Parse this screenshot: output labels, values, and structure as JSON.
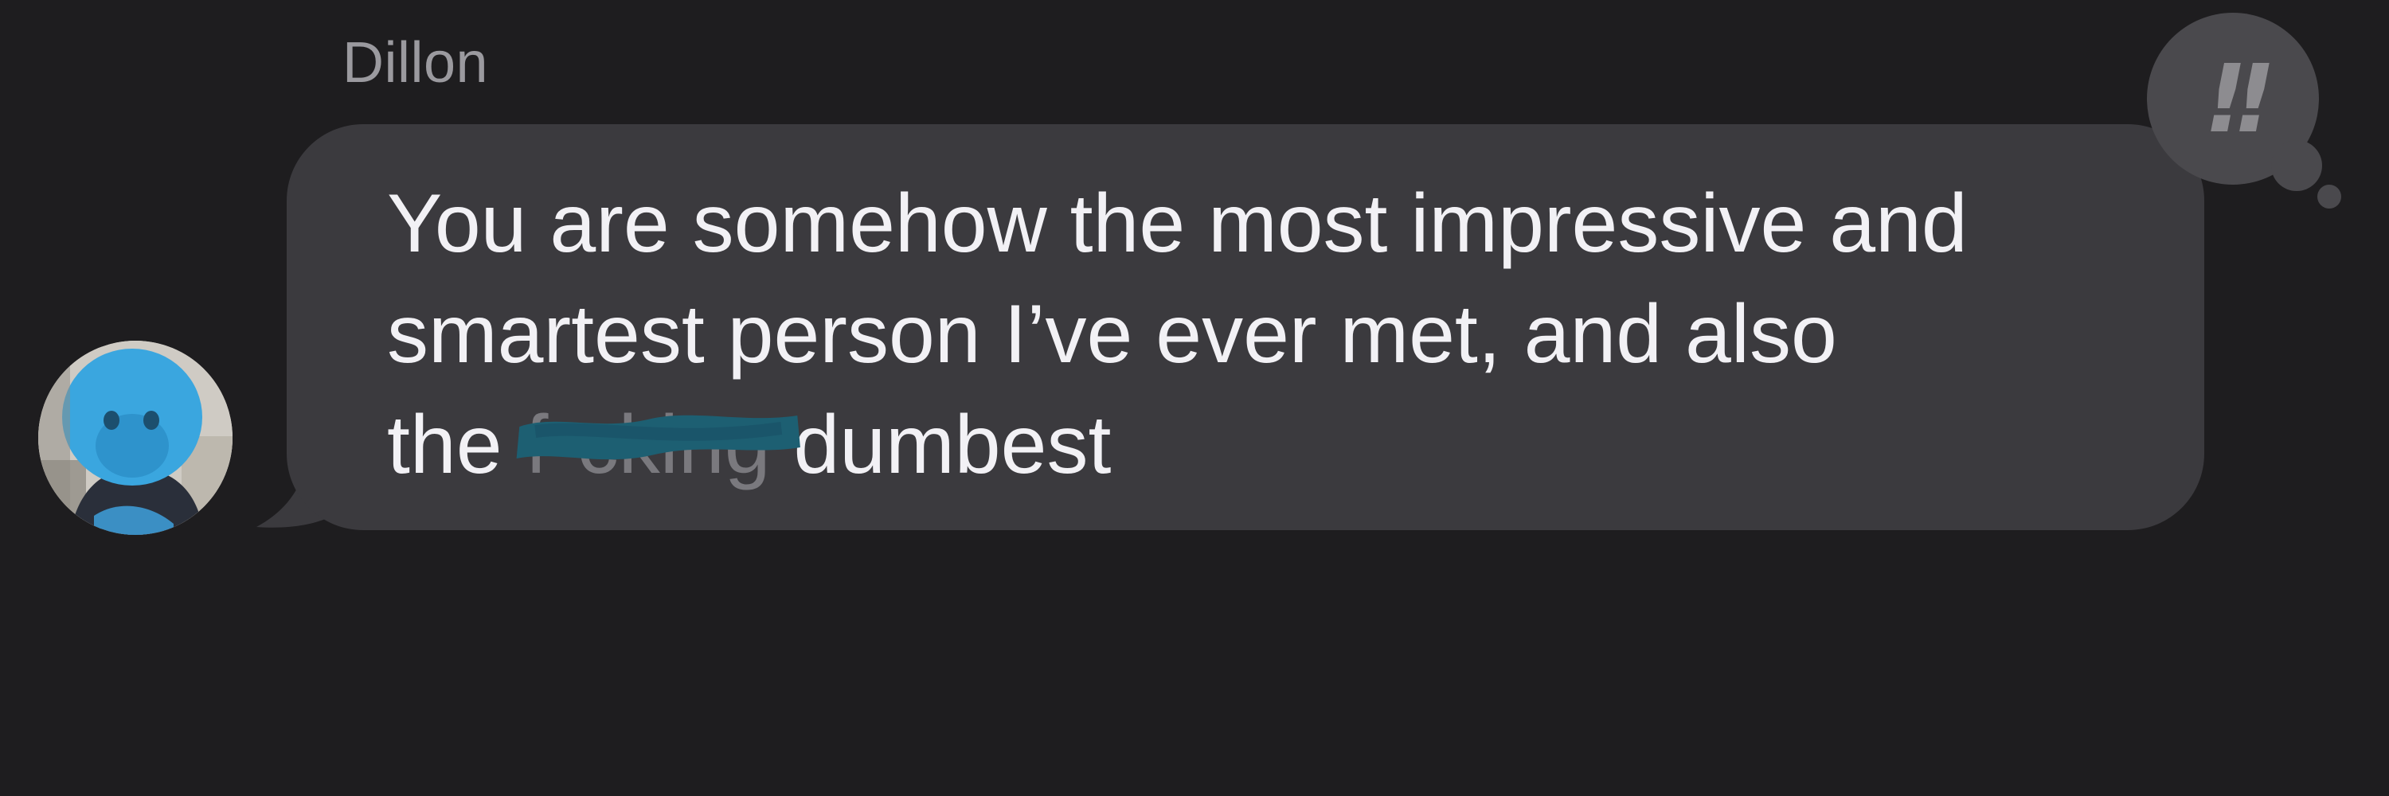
{
  "conversation": {
    "sender_name": "Dillon",
    "message": {
      "line1": "You are somehow the most impressive and",
      "line2": "smartest person I’ve ever met, and also",
      "line3_before": "the ",
      "line3_redacted": "f•cking",
      "line3_after": " dumbest"
    },
    "tapback": {
      "icon": "double-exclamation-icon",
      "glyph": "!!"
    },
    "avatar": {
      "icon": "avatar-photo"
    }
  },
  "colors": {
    "background": "#1e1d1f",
    "bubble": "#3b3a3e",
    "text": "#f2f1f5",
    "sender": "#9b9a9f",
    "redaction": "#1d5f72",
    "tapback_bg": "#4a494d",
    "tapback_glyph": "#8d8c90"
  }
}
